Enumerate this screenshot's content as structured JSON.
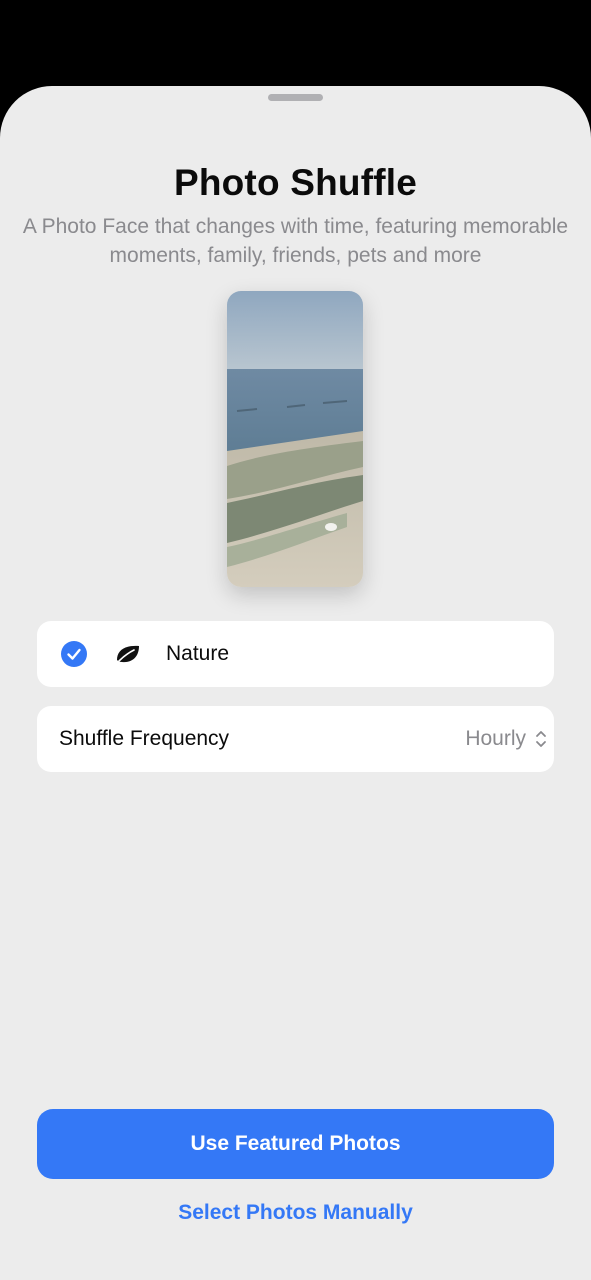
{
  "sheet": {
    "title": "Photo Shuffle",
    "subtitle": "A Photo Face that changes with time, featuring memorable moments, family, friends, pets and more"
  },
  "preview": {
    "subject": "shoreline photo preview"
  },
  "categories": [
    {
      "label": "Nature",
      "selected": true,
      "icon": "leaf-icon"
    }
  ],
  "shuffle": {
    "label": "Shuffle Frequency",
    "value": "Hourly"
  },
  "actions": {
    "primary_label": "Use Featured Photos",
    "secondary_label": "Select Photos Manually"
  },
  "colors": {
    "accent": "#3478f6",
    "sheet_background": "#ececec",
    "card_background": "#ffffff",
    "secondary_text": "#8a8a8e"
  }
}
